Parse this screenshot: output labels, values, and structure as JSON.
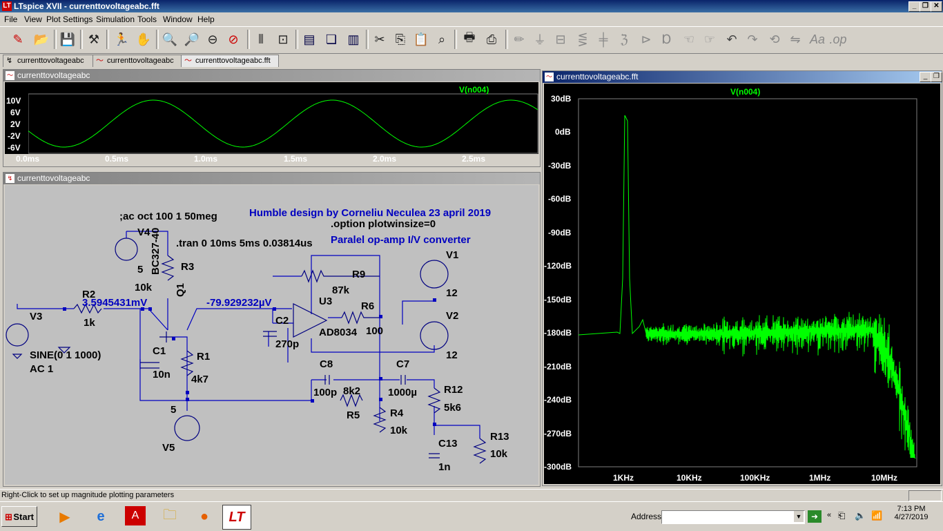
{
  "app": {
    "title": "LTspice XVII - currenttovoltageabc.fft"
  },
  "menu": [
    "File",
    "View",
    "Plot Settings",
    "Simulation",
    "Tools",
    "Window",
    "Help"
  ],
  "tabs": [
    "currenttovoltageabc",
    "currenttovoltageabc",
    "currenttovoltageabc.fft"
  ],
  "time_plot": {
    "title": "currenttovoltageabc",
    "trace": "V(n004)",
    "y_ticks": [
      "10V",
      "6V",
      "2V",
      "-2V",
      "-6V"
    ],
    "x_ticks": [
      "0.0ms",
      "0.5ms",
      "1.0ms",
      "1.5ms",
      "2.0ms",
      "2.5ms"
    ]
  },
  "schematic": {
    "title": "currenttovoltageabc",
    "texts": {
      "ac": ";ac oct 100 1 50meg",
      "humble": "Humble design by Corneliu Neculea 23 april 2019",
      "option": ".option plotwinsize=0",
      "tran": ".tran 0 10ms 5ms 0.03814us",
      "paralel": "Paralel op-amp I/V converter",
      "v4": "V4",
      "v4val": "5",
      "bc": "BC327-40",
      "q1": "Q1",
      "r3": "R3",
      "r3val": "10k",
      "r2": "R2",
      "r2val": "1k",
      "node1": "3.5945431mV",
      "node2": "-79.929232µV",
      "v3": "V3",
      "sine": "SINE(0 1 1000)",
      "ac1": "AC 1",
      "c1": "C1",
      "c1val": "10n",
      "r1": "R1",
      "r1val": "4k7",
      "v5": "V5",
      "v5val": "5",
      "r9": "R9",
      "r9val": "87k",
      "u3": "U3",
      "r6": "R6",
      "r6val": "100",
      "c2": "C2",
      "c2val": "270p",
      "ad": "AD8034",
      "v1": "V1",
      "v1val": "12",
      "v2": "V2",
      "v2val": "12",
      "c8": "C8",
      "c8val": "100p",
      "r5val": "8k2",
      "r5": "R5",
      "c7": "C7",
      "c7val": "1000µ",
      "r4": "R4",
      "r4val": "10k",
      "r12": "R12",
      "r12val": "5k6",
      "c13": "C13",
      "c13val": "1n",
      "r13": "R13",
      "r13val": "10k"
    }
  },
  "fft_plot": {
    "title": "currenttovoltageabc.fft",
    "trace": "V(n004)",
    "y_ticks": [
      "30dB",
      "0dB",
      "-30dB",
      "-60dB",
      "-90dB",
      "-120dB",
      "-150dB",
      "-180dB",
      "-210dB",
      "-240dB",
      "-270dB",
      "-300dB"
    ],
    "x_ticks": [
      "1KHz",
      "10KHz",
      "100KHz",
      "1MHz",
      "10MHz"
    ]
  },
  "status": {
    "text": "Right-Click to set up magnitude plotting parameters"
  },
  "taskbar": {
    "start": "Start",
    "address_label": "Address",
    "time": "7:13 PM",
    "date": "4/27/2019"
  },
  "colors": {
    "trace": "#00ff00",
    "schematic_bg": "#c0c0c0",
    "wire": "#0000c0"
  }
}
